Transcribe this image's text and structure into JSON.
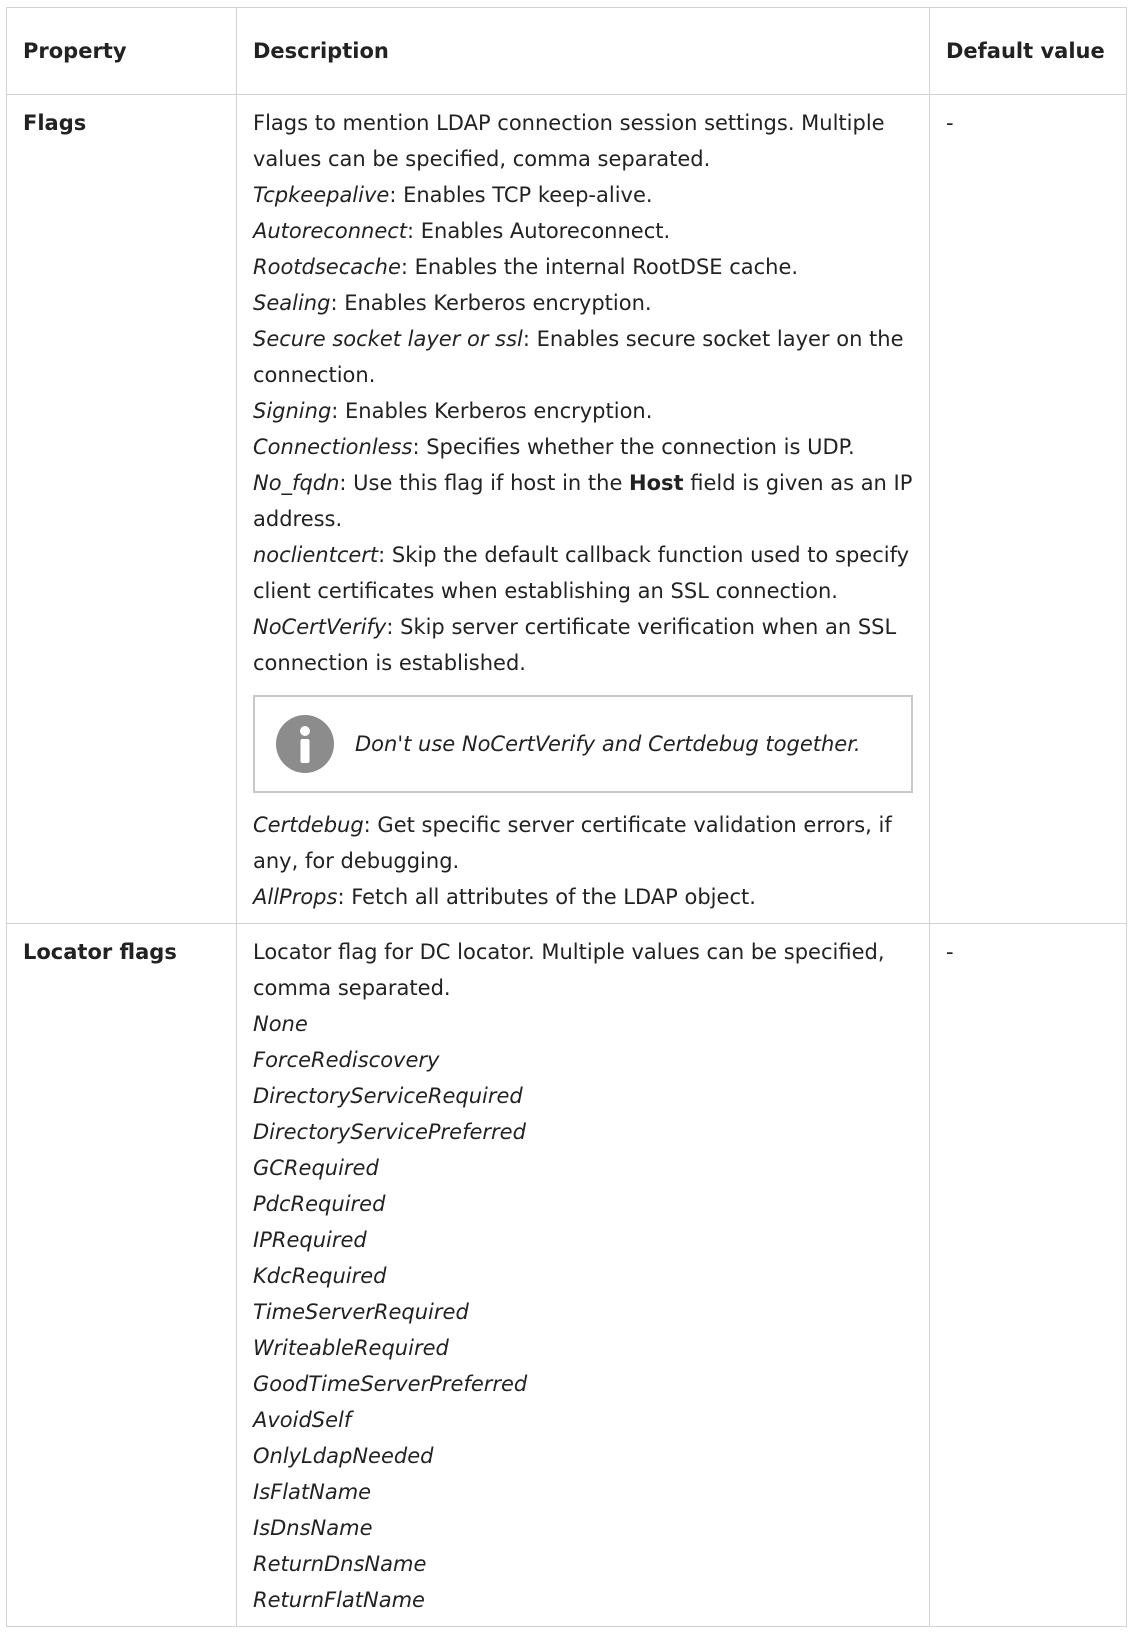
{
  "table": {
    "headers": [
      "Property",
      "Description",
      "Default value"
    ],
    "rows": [
      {
        "property": "Flags",
        "description_intro": "Flags to mention LDAP connection session settings. Multiple values can be specified, comma separated.",
        "items": [
          {
            "term": "Tcpkeepalive",
            "text": ": Enables TCP keep-alive."
          },
          {
            "term": "Autoreconnect",
            "text": ": Enables Autoreconnect."
          },
          {
            "term": "Rootdsecache",
            "text": ": Enables the internal RootDSE cache."
          },
          {
            "term": "Sealing",
            "text": ": Enables Kerberos encryption."
          },
          {
            "term": "Secure socket layer or ssl",
            "text": ": Enables secure socket layer on the connection."
          },
          {
            "term": "Signing",
            "text": ": Enables Kerberos encryption."
          },
          {
            "term": "Connectionless",
            "text": ": Specifies whether the connection is UDP."
          },
          {
            "term": "No_fqdn",
            "text_before": ": Use this flag if host in the ",
            "bold": "Host",
            "text_after": " field is given as an IP address."
          },
          {
            "term": "noclientcert",
            "text": ": Skip the default callback function used to specify client certificates when establishing an SSL connection."
          },
          {
            "term": "NoCertVerify",
            "text": ": Skip server certificate verification when an SSL connection is established."
          }
        ],
        "note": "Don't use NoCertVerify and Certdebug together.",
        "note_icon": "info-icon",
        "items_after": [
          {
            "term": "Certdebug",
            "text": ": Get specific server certificate validation errors, if any, for debugging."
          },
          {
            "term": "AllProps",
            "text": ": Fetch all attributes of the LDAP object."
          }
        ],
        "default": "-"
      },
      {
        "property": "Locator flags",
        "description_intro": "Locator flag for DC locator. Multiple values can be specified, comma separated.",
        "values": [
          "None",
          "ForceRediscovery",
          "DirectoryServiceRequired",
          "DirectoryServicePreferred",
          "GCRequired",
          "PdcRequired",
          "IPRequired",
          "KdcRequired",
          "TimeServerRequired",
          "WriteableRequired",
          "GoodTimeServerPreferred",
          "AvoidSelf",
          "OnlyLdapNeeded",
          "IsFlatName",
          "IsDnsName",
          "ReturnDnsName",
          "ReturnFlatName"
        ],
        "default": "-"
      }
    ]
  }
}
